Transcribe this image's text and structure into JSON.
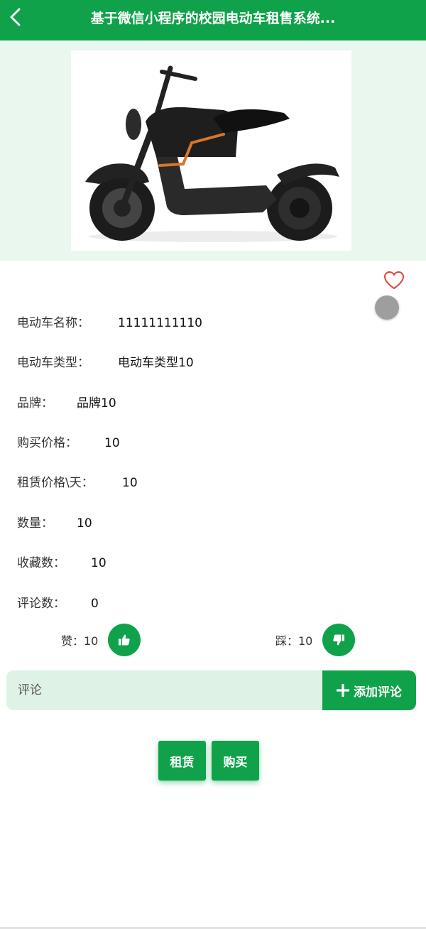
{
  "header": {
    "title": "基于微信小程序的校园电动车租售系统...",
    "back_icon": "chevron-left-icon",
    "background": "#0fa24a"
  },
  "product": {
    "image_alt": "电动车",
    "favorite_icon": "heart-outline-icon",
    "fields": [
      {
        "label": "电动车名称：",
        "value": "11111111110"
      },
      {
        "label": "电动车类型：",
        "value": "电动车类型10"
      },
      {
        "label": "品牌：",
        "value": "品牌10"
      },
      {
        "label": "购买价格：",
        "value": "10"
      },
      {
        "label": "租赁价格\\天：",
        "value": "10"
      },
      {
        "label": "数量：",
        "value": "10"
      },
      {
        "label": "收藏数：",
        "value": "10"
      },
      {
        "label": "评论数：",
        "value": "0"
      }
    ]
  },
  "votes": {
    "like_label": "赞：10",
    "dislike_label": "踩：10",
    "like_icon": "thumbs-up-icon",
    "dislike_icon": "thumbs-down-icon"
  },
  "comment": {
    "placeholder": "评论",
    "add_label": "添加评论",
    "add_icon": "plus-icon"
  },
  "actions": {
    "rent_label": "租赁",
    "buy_label": "购买"
  },
  "colors": {
    "accent": "#0fa24a",
    "hero_bg": "#eaf7ee",
    "comment_bg": "#dff2e6",
    "heart": "#e0403c"
  }
}
